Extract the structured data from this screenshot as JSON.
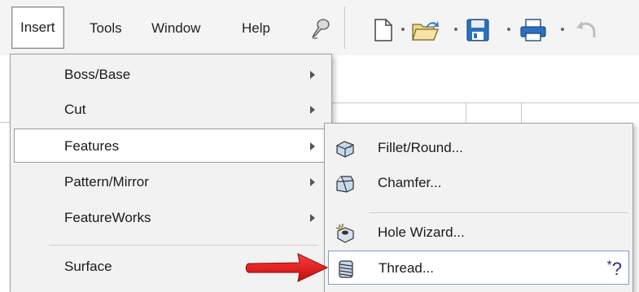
{
  "menubar": {
    "items": [
      {
        "label": "Insert",
        "active": true
      },
      {
        "label": "Tools"
      },
      {
        "label": "Window"
      },
      {
        "label": "Help"
      }
    ],
    "pin_icon": "pushpin-icon",
    "toolbar_icons": [
      "new-document-icon",
      "open-folder-icon",
      "save-icon",
      "print-icon",
      "undo-icon"
    ]
  },
  "insert_menu": {
    "items": [
      {
        "label": "Boss/Base",
        "has_submenu": true
      },
      {
        "label": "Cut",
        "has_submenu": true
      },
      {
        "label": "Features",
        "has_submenu": true,
        "highlighted": true
      },
      {
        "label": "Pattern/Mirror",
        "has_submenu": true
      },
      {
        "label": "FeatureWorks",
        "has_submenu": true
      },
      {
        "label": "Surface",
        "has_submenu": true
      }
    ]
  },
  "features_submenu": {
    "items": [
      {
        "label": "Fillet/Round...",
        "icon": "fillet-icon"
      },
      {
        "label": "Chamfer...",
        "icon": "chamfer-icon"
      },
      {
        "label": "Hole Wizard...",
        "icon": "hole-wizard-icon"
      },
      {
        "label": "Thread...",
        "icon": "thread-icon",
        "highlighted": true,
        "badge": "?",
        "badge_mark": "*"
      }
    ]
  },
  "annotation": {
    "icon": "red-arrow-icon",
    "color": "#e02020"
  },
  "colors": {
    "menu_bg": "#f2f2f2",
    "highlight_border": "#7f9ec6",
    "arrow": "#e02020",
    "toolbar_icon": "#1f5fb0"
  }
}
